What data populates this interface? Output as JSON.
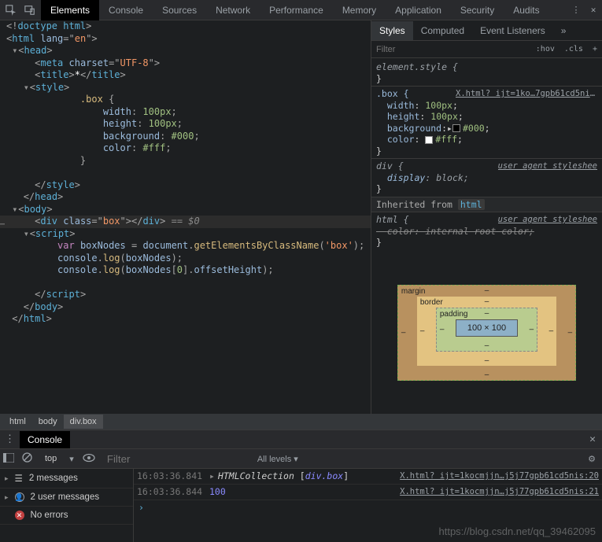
{
  "topTabs": {
    "elements": "Elements",
    "console": "Console",
    "sources": "Sources",
    "network": "Network",
    "performance": "Performance",
    "memory": "Memory",
    "application": "Application",
    "security": "Security",
    "audits": "Audits"
  },
  "stylesTabs": {
    "styles": "Styles",
    "computed": "Computed",
    "event": "Event Listeners"
  },
  "stylesFilter": {
    "placeholder": "Filter",
    "hov": ":hov",
    "cls": ".cls"
  },
  "rules": {
    "elStyle": "element.style {",
    "elStyleClose": "}",
    "boxSel": ".box {",
    "boxSrc": "X.html? ijt=1ko…7gpb61cd5nis:",
    "widthProp": "width",
    "widthVal": "100px",
    "heightProp": "height",
    "heightVal": "100px",
    "bgProp": "background",
    "bgVal": "#000",
    "colorProp": "color",
    "colorVal": "#fff",
    "close": "}",
    "divSel": "div {",
    "uaLabel": "user agent styleshee",
    "displayProp": "display",
    "displayVal": "block",
    "inhLabel": "Inherited from ",
    "inhTag": "html",
    "htmlSel": "html {",
    "strike": "color:  internal root color;"
  },
  "dom": {
    "doctype": "<!doctype html>",
    "htmlOpen": "<html lang=\"en\">",
    "headOpen": "<head>",
    "meta": "<meta charset=\"UTF-8\">",
    "title": "<title>*</title>",
    "styleOpen": "<style>",
    "cssSel": ".box {",
    "cssWidth": "width: 100px;",
    "cssHeight": "height: 100px;",
    "cssBg": "background: #000;",
    "cssColor": "color: #fff;",
    "cssClose": "}",
    "styleClose": "</style>",
    "headClose": "</head>",
    "bodyOpen": "<body>",
    "divLine": "<div class=\"box\"></div> == $0",
    "scriptOpen": "<script>",
    "js1": "var boxNodes = document.getElementsByClassName('box');",
    "js2": "console.log(boxNodes);",
    "js3": "console.log(boxNodes[0].offsetHeight);",
    "scriptClose": "</script>",
    "bodyClose": "</body>",
    "htmlClose": "</html>"
  },
  "boxModel": {
    "margin": "margin",
    "border": "border",
    "padding": "padding",
    "content": "100 × 100",
    "mdash": "–",
    "bdash": "–",
    "pdash": "–"
  },
  "crumbs": {
    "html": "html",
    "body": "body",
    "div": "div.box"
  },
  "drawer": {
    "tab": "Console"
  },
  "consoleTb": {
    "context": "top",
    "filterPh": "Filter",
    "levels": "All levels"
  },
  "sideRows": {
    "messages": "2 messages",
    "userMsgs": "2 user messages",
    "noErrors": "No errors"
  },
  "logs": {
    "ts1": "16:03:36.841",
    "cls": "HTMLCollection ",
    "brk1": "[",
    "item": "div.box",
    "brk2": "]",
    "src1": "X.html? ijt=1kocmjjn…j5j77gpb61cd5nis:20",
    "ts2": "16:03:36.844",
    "val2": "100",
    "src2": "X.html? ijt=1kocmjjn…j5j77gpb61cd5nis:21"
  },
  "watermark": "https://blog.csdn.net/qq_39462095"
}
